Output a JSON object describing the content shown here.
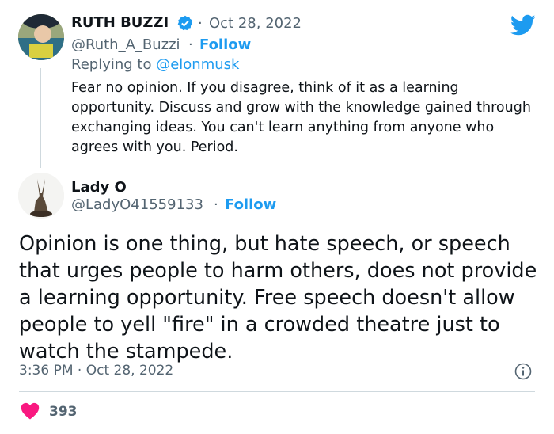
{
  "reply_tweet": {
    "author_name": "RUTH BUZZI",
    "date": "Oct 28, 2022",
    "handle": "@Ruth_A_Buzzi",
    "follow_label": "Follow",
    "replying_to_prefix": "Replying to",
    "replying_to_handle": "@elonmusk",
    "text": "Fear no opinion. If you disagree, think of it as a learning opportunity.  Discuss and grow with the knowledge gained through exchanging ideas.  You can't learn anything from anyone who agrees with you.  Period.",
    "verified_icon": "verified-badge-icon"
  },
  "main_tweet": {
    "author_name": "Lady O",
    "handle": "@LadyO41559133",
    "follow_label": "Follow",
    "text": "Opinion is one thing, but hate speech, or speech that urges people to harm others, does not provide a learning opportunity. Free speech doesn't allow people to yell \"fire\" in a crowded theatre just to watch the stampede.",
    "time": "3:36 PM",
    "date": "Oct 28, 2022",
    "like_count": "393"
  },
  "colors": {
    "accent": "#1d9bf0",
    "heart": "#f91880",
    "muted": "#536471",
    "text": "#0f1419"
  }
}
